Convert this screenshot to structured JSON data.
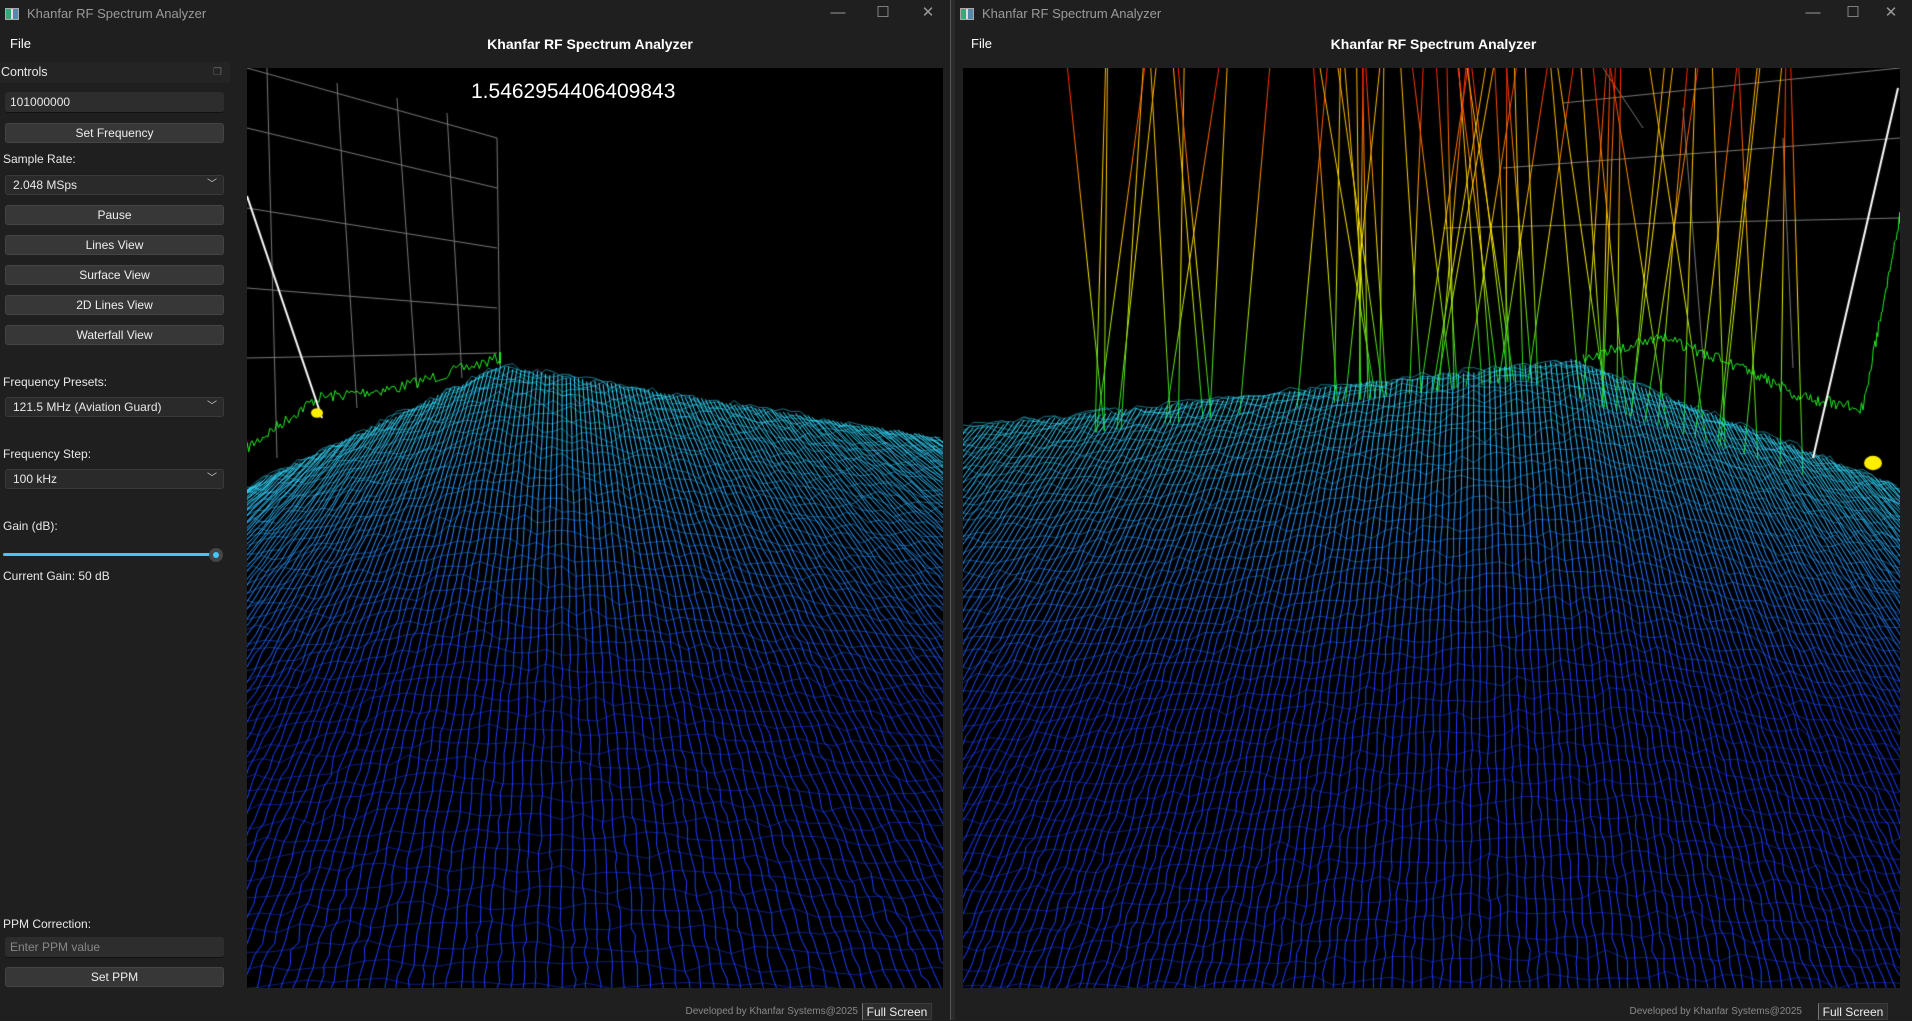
{
  "windows": [
    {
      "window_title": "Khanfar RF Spectrum Analyzer",
      "menu": {
        "file": "File"
      },
      "app_title": "Khanfar RF Spectrum Analyzer",
      "readout": "1.5462954406409843",
      "footer": "Developed by Khanfar Systems@2025",
      "fullscreen_label": "Full Screen"
    },
    {
      "window_title": "Khanfar RF Spectrum Analyzer",
      "menu": {
        "file": "File"
      },
      "app_title": "Khanfar RF Spectrum Analyzer",
      "footer": "Developed by Khanfar Systems@2025",
      "fullscreen_label": "Full Screen"
    }
  ],
  "window_controls": {
    "minimize": "—",
    "maximize": "☐",
    "close": "✕"
  },
  "controls": {
    "header": "Controls",
    "frequency_value": "101000000",
    "set_frequency": "Set Frequency",
    "sample_rate_label": "Sample Rate:",
    "sample_rate": "2.048 MSps",
    "pause": "Pause",
    "lines_view": "Lines View",
    "surface_view": "Surface View",
    "lines_2d_view": "2D Lines View",
    "waterfall_view": "Waterfall View",
    "presets_label": "Frequency Presets:",
    "preset": "121.5 MHz (Aviation Guard)",
    "step_label": "Frequency Step:",
    "step": "100 kHz",
    "gain_label": "Gain (dB):",
    "gain_fraction": 1.0,
    "current_gain": "Current Gain: 50 dB",
    "ppm_label": "PPM Correction:",
    "ppm_placeholder": "Enter PPM value",
    "set_ppm": "Set PPM"
  },
  "colors": {
    "accent": "#4cc2ff",
    "surface_near": "#1a3cff",
    "surface_far": "#33ddff",
    "trace": "#22ee22",
    "marker": "#ffee00"
  }
}
